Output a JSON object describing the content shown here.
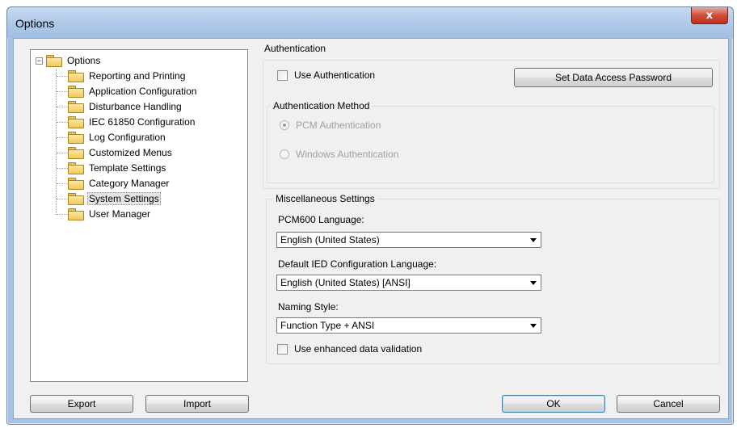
{
  "window": {
    "title": "Options",
    "close_glyph": "x"
  },
  "tree": {
    "root": {
      "label": "Options",
      "expander": "−"
    },
    "items": [
      {
        "label": "Reporting and Printing"
      },
      {
        "label": "Application Configuration"
      },
      {
        "label": "Disturbance Handling"
      },
      {
        "label": "IEC 61850 Configuration"
      },
      {
        "label": "Log Configuration"
      },
      {
        "label": "Customized Menus"
      },
      {
        "label": "Template Settings"
      },
      {
        "label": "Category Manager"
      },
      {
        "label": "System Settings",
        "selected": true
      },
      {
        "label": "User Manager"
      }
    ]
  },
  "authentication": {
    "group_title": "Authentication",
    "use_auth_label": "Use Authentication",
    "use_auth_checked": false,
    "set_password_button": "Set Data Access Password",
    "method": {
      "group_title": "Authentication Method",
      "options": [
        {
          "label": "PCM Authentication",
          "checked": true,
          "enabled": false
        },
        {
          "label": "Windows Authentication",
          "checked": false,
          "enabled": false
        }
      ]
    }
  },
  "misc": {
    "group_title": "Miscellaneous Settings",
    "language_label": "PCM600 Language:",
    "language_value": "English (United States)",
    "ied_language_label": "Default IED Configuration Language:",
    "ied_language_value": "English (United States) [ANSI]",
    "naming_label": "Naming Style:",
    "naming_value": "Function Type + ANSI",
    "validation_label": "Use enhanced data validation",
    "validation_checked": false
  },
  "buttons": {
    "export": "Export",
    "import": "Import",
    "ok": "OK",
    "cancel": "Cancel"
  },
  "colors": {
    "title_bar": "#b2cbe8",
    "close_button": "#c7402b",
    "client_background": "#f0f0f0",
    "default_button_border": "#3c7fb1"
  }
}
